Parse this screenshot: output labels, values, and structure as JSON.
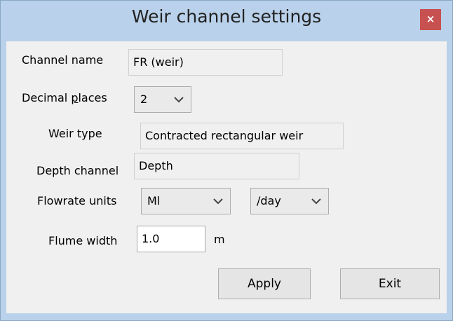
{
  "window": {
    "title": "Weir channel settings",
    "close_glyph": "×"
  },
  "fields": {
    "channel_name_label": "Channel name",
    "channel_name_value": "FR (weir)",
    "decimal_places_label_pre": "Decimal ",
    "decimal_places_label_mnemonic": "p",
    "decimal_places_label_post": "laces",
    "decimal_places_value": "2",
    "weir_type_label": "Weir type",
    "weir_type_value": "Contracted rectangular weir",
    "depth_channel_label": "Depth channel",
    "depth_channel_value": "Depth",
    "flowrate_units_label": "Flowrate units",
    "flowrate_volume_value": "Ml",
    "flowrate_time_value": "/day",
    "flume_width_label": "Flume width",
    "flume_width_value": "1.0",
    "flume_width_unit": "m"
  },
  "buttons": {
    "apply": "Apply",
    "exit": "Exit"
  },
  "colors": {
    "titlebar": "#b9d1ea",
    "close": "#c75050",
    "dialog": "#f0f0f0"
  },
  "icons": [
    "close-icon",
    "chevron-down-icon"
  ]
}
